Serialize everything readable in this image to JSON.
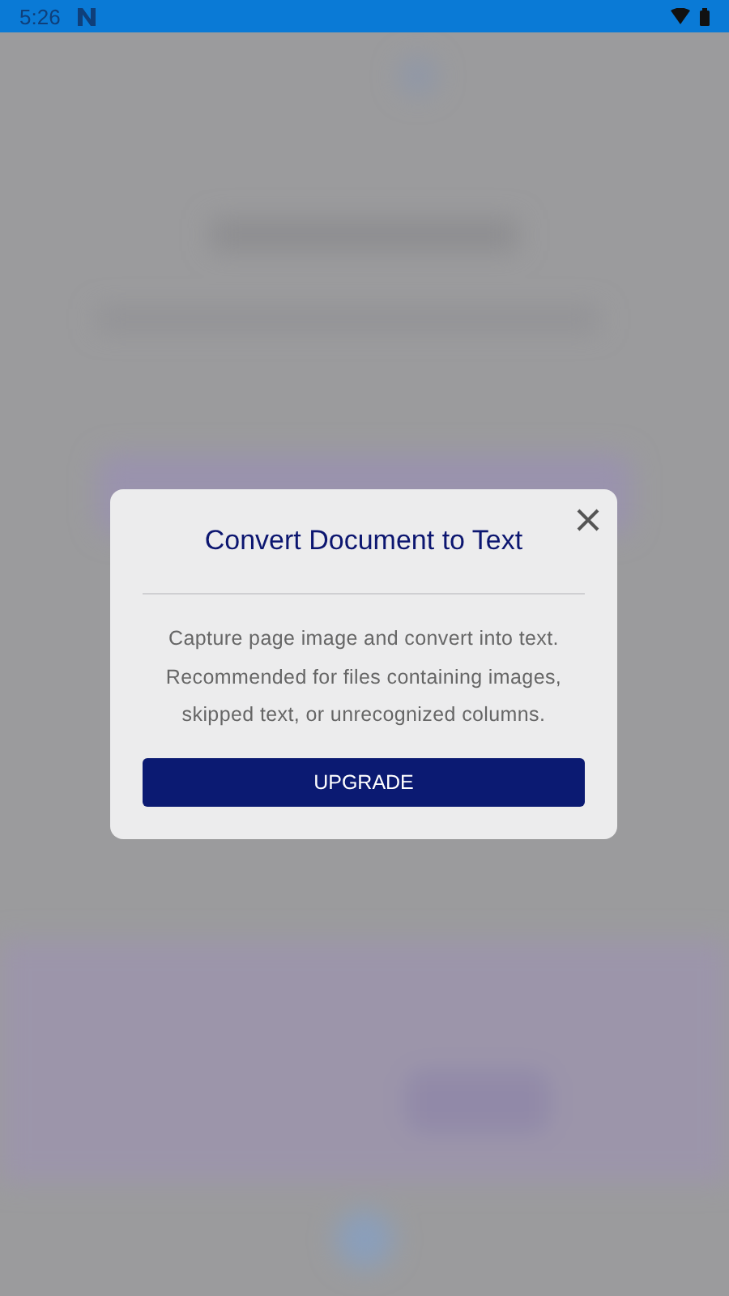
{
  "status_bar": {
    "time": "5:26"
  },
  "dialog": {
    "title": "Convert Document to Text",
    "message": "Capture page image and convert into text. Recommended for files containing images, skipped text, or unrecognized columns.",
    "button": "UPGRADE"
  }
}
